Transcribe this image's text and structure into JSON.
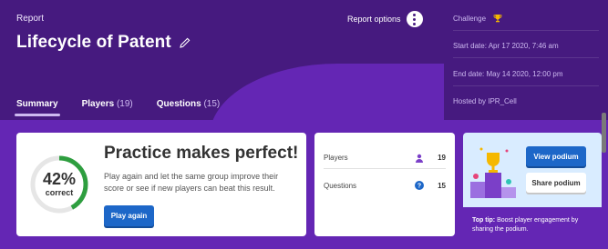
{
  "header": {
    "report_label": "Report",
    "title": "Lifecycle of Patent",
    "report_options_label": "Report options"
  },
  "tabs": [
    {
      "label": "Summary",
      "count": ""
    },
    {
      "label": "Players",
      "count": "(19)"
    },
    {
      "label": "Questions",
      "count": "(15)"
    }
  ],
  "info": {
    "mode": "Challenge",
    "start_date": "Start date: Apr 17 2020, 7:46 am",
    "end_date": "End date: May 14 2020, 12:00 pm",
    "hosted_by": "Hosted by IPR_Cell"
  },
  "accuracy": {
    "percent_text": "42%",
    "percent_value": 42,
    "label": "correct",
    "headline": "Practice makes perfect!",
    "description": "Play again and let the same group improve their score or see if new players can beat this result.",
    "play_again_label": "Play again"
  },
  "stats": {
    "players_label": "Players",
    "players_value": "19",
    "questions_label": "Questions",
    "questions_value": "15"
  },
  "podium": {
    "view_label": "View podium",
    "share_label": "Share podium",
    "tip_prefix": "Top tip:",
    "tip_text": " Boost player engagement by sharing the podium."
  },
  "icons": {
    "edit": "pencil-icon",
    "options": "kebab-menu-icon",
    "trophy": "trophy-icon",
    "players": "person-icon",
    "questions": "question-icon"
  },
  "colors": {
    "header_bg": "#461a7f",
    "page_bg": "#6426b4",
    "primary_button": "#1d67c8",
    "gauge_green": "#2e9e3f",
    "trophy_gold": "#f5b800"
  }
}
